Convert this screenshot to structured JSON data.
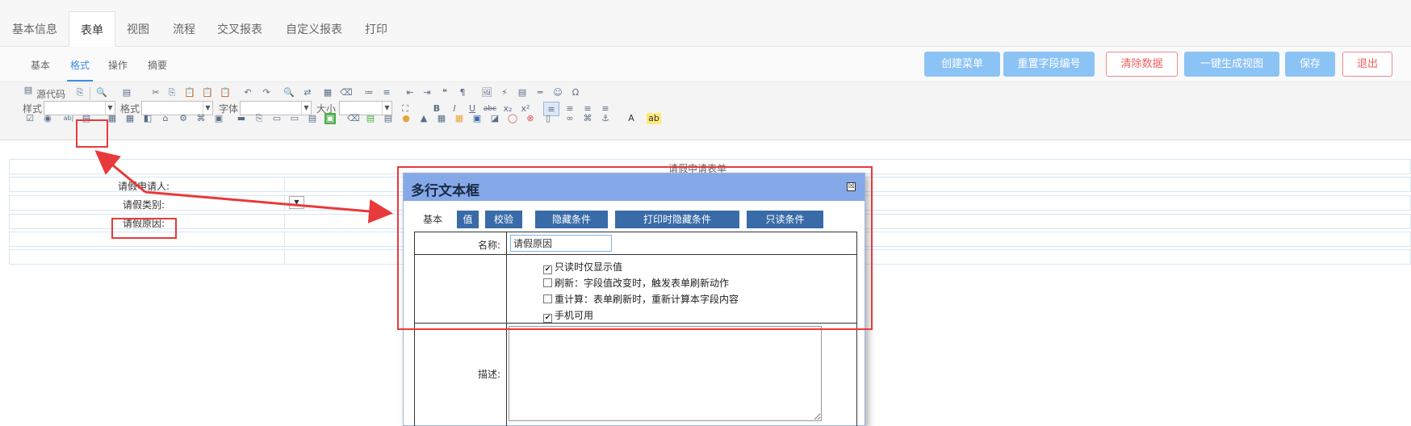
{
  "top_tabs": [
    "基本信息",
    "表单",
    "视图",
    "流程",
    "交叉报表",
    "自定义报表",
    "打印"
  ],
  "sub_tabs": [
    "基本",
    "格式",
    "操作",
    "摘要"
  ],
  "actions": {
    "create_menu": "创建菜单",
    "reset_field_no": "重置字段编号",
    "clear_data": "清除数据",
    "gen_view": "一键生成视图",
    "save": "保存",
    "exit": "退出"
  },
  "toolbar": {
    "source": "源代码",
    "style": "样式",
    "format": "格式",
    "font": "字体",
    "size": "大小",
    "icons_row1": [
      "✂",
      "⎘",
      "📋",
      "📋",
      "📋",
      "↶",
      "↷",
      "🔍",
      "⇄",
      "▦",
      "⌫",
      "≔",
      "≡",
      "⇤",
      "⇥",
      "❝",
      "¶",
      "🖼",
      "⚡",
      "▤",
      "═",
      "☺",
      "Ω"
    ],
    "icons_row2": [
      "B",
      "I",
      "U",
      "abc",
      "x₂",
      "x²",
      "≡",
      "≡",
      "≡",
      "≡"
    ],
    "icons_row3": [
      "☑",
      "◉",
      "ab|",
      "▤",
      "▦",
      "▦",
      "◧",
      "⌂",
      "⚙",
      "⌘",
      "▣",
      "▬",
      "⎘",
      "▭",
      "▭",
      "▤",
      "▣",
      "⌫",
      "▤",
      "▤",
      "●",
      "▲",
      "▦",
      "▦",
      "▣",
      "◪",
      "◯",
      "⊗",
      "▯",
      "∞",
      "⌘",
      "⚓",
      "A",
      "ab"
    ]
  },
  "form": {
    "title": "请假申请表单",
    "rows": [
      {
        "label": "请假申请人:"
      },
      {
        "label": "请假类别:",
        "select_arrow": "▼"
      },
      {
        "label": "请假原因:"
      }
    ]
  },
  "dialog": {
    "title": "多行文本框",
    "close": "☒",
    "tabs": [
      "基本",
      "值",
      "校验",
      "隐藏条件",
      "打印时隐藏条件",
      "只读条件"
    ],
    "name_label": "名称:",
    "name_value": "请假原因",
    "checkboxes": [
      {
        "label": "只读时仅显示值",
        "checked": true
      },
      {
        "label": "刷新：字段值改变时，触发表单刷新动作",
        "checked": false
      },
      {
        "label": "重计算：表单刷新时，重新计算本字段内容",
        "checked": false
      },
      {
        "label": "手机可用",
        "checked": true
      }
    ],
    "desc_label": "描述:"
  },
  "colors": {
    "accent": "#3a8ee6",
    "button_blue": "#8cc3f5",
    "dialog_header": "#85a9e8",
    "dialog_tab": "#396ba8",
    "annotation_red": "#e83a3a"
  }
}
